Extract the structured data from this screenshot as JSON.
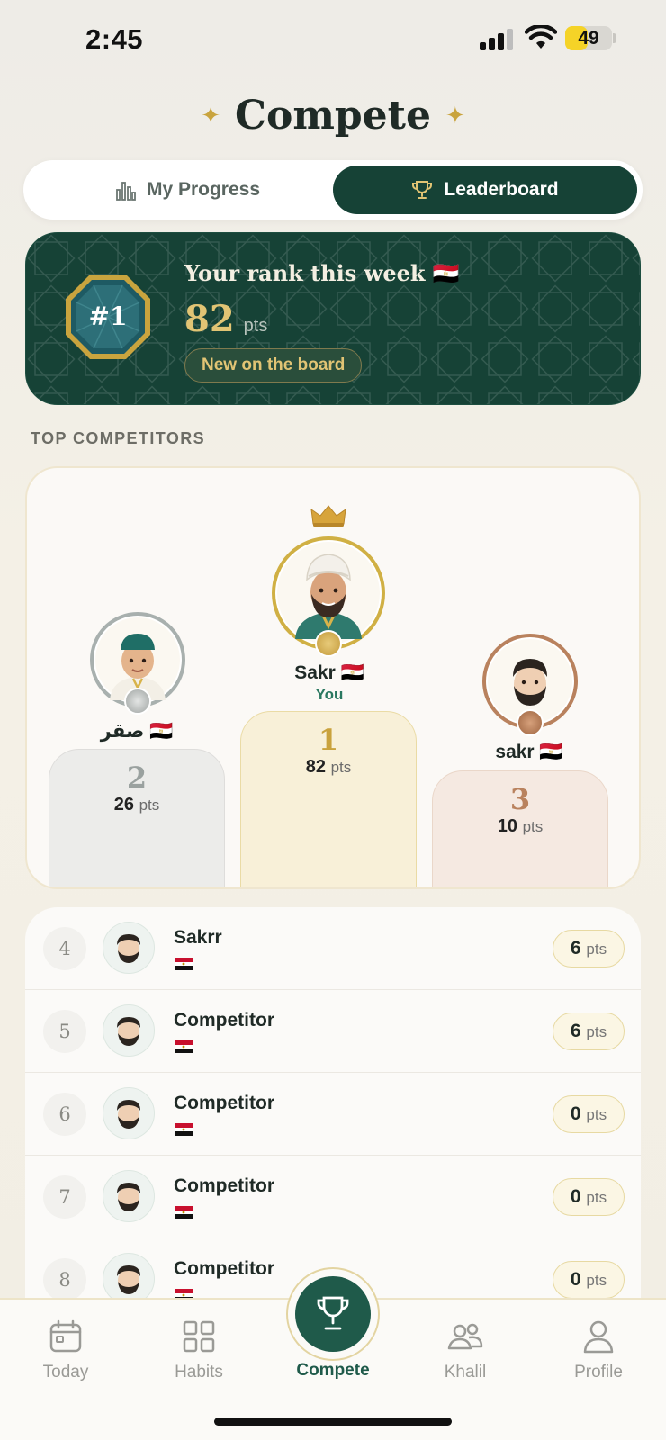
{
  "status_bar": {
    "time": "2:45",
    "battery": "49",
    "battery_level": 0.49
  },
  "header": {
    "title": "Compete",
    "sparkle_icon": "sparkle-icon"
  },
  "segmented": {
    "tabs": [
      {
        "label": "My Progress",
        "icon": "bar-chart-icon",
        "selected": false
      },
      {
        "label": "Leaderboard",
        "icon": "trophy-icon",
        "selected": true
      }
    ]
  },
  "rank_card": {
    "badge": "#1",
    "title": "Your rank this week 🇪🇬",
    "points": "82",
    "points_unit": "pts",
    "chip": "New on the board"
  },
  "section_label": "TOP COMPETITORS",
  "podium": {
    "first": {
      "name": "Sakr 🇪🇬",
      "you_label": "You",
      "rank": "1",
      "points": "82",
      "unit": "pts"
    },
    "second": {
      "name": "صقر 🇪🇬",
      "rank": "2",
      "points": "26",
      "unit": "pts"
    },
    "third": {
      "name": "sakr 🇪🇬",
      "rank": "3",
      "points": "10",
      "unit": "pts"
    }
  },
  "list": [
    {
      "rank": "4",
      "name": "Sakrr",
      "points": "6",
      "unit": "pts"
    },
    {
      "rank": "5",
      "name": "Competitor",
      "points": "6",
      "unit": "pts"
    },
    {
      "rank": "6",
      "name": "Competitor",
      "points": "0",
      "unit": "pts"
    },
    {
      "rank": "7",
      "name": "Competitor",
      "points": "0",
      "unit": "pts"
    },
    {
      "rank": "8",
      "name": "Competitor",
      "points": "0",
      "unit": "pts"
    }
  ],
  "tab_bar": {
    "items": [
      {
        "label": "Today",
        "icon": "calendar-icon"
      },
      {
        "label": "Habits",
        "icon": "grid-icon"
      },
      {
        "label": "Compete",
        "icon": "trophy-icon",
        "active": true
      },
      {
        "label": "Khalil",
        "icon": "people-icon"
      },
      {
        "label": "Profile",
        "icon": "person-icon"
      }
    ]
  },
  "colors": {
    "brand_green": "#164236",
    "gold": "#e1c474",
    "silver": "#a8aeac",
    "bronze": "#b9825e"
  }
}
